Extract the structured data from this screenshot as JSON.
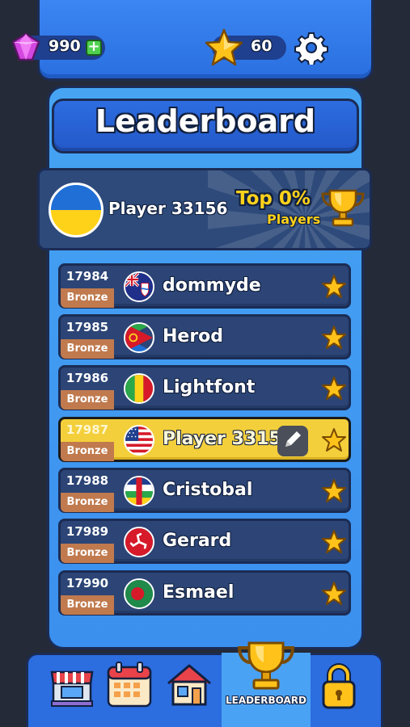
{
  "topbar": {
    "gem_count": "990",
    "plus_label": "+",
    "star_count": "60"
  },
  "title": "Leaderboard",
  "player_card": {
    "name": "Player 33156",
    "top_label": "Top 0%",
    "players_label": "Players"
  },
  "rows": [
    {
      "rank": "17984",
      "tier": "Bronze",
      "name": "dommyde",
      "flag": "cayman-islands",
      "me": false
    },
    {
      "rank": "17985",
      "tier": "Bronze",
      "name": "Herod",
      "flag": "eritrea",
      "me": false
    },
    {
      "rank": "17986",
      "tier": "Bronze",
      "name": "Lightfont",
      "flag": "mali",
      "me": false
    },
    {
      "rank": "17987",
      "tier": "Bronze",
      "name": "Player 33156",
      "flag": "usa",
      "me": true
    },
    {
      "rank": "17988",
      "tier": "Bronze",
      "name": "Cristobal",
      "flag": "central-african-republic",
      "me": false
    },
    {
      "rank": "17989",
      "tier": "Bronze",
      "name": "Gerard",
      "flag": "isle-of-man",
      "me": false
    },
    {
      "rank": "17990",
      "tier": "Bronze",
      "name": "Esmael",
      "flag": "bangladesh",
      "me": false
    }
  ],
  "nav": {
    "active_label": "LEADERBOARD",
    "items": [
      "shop-icon",
      "calendar-icon",
      "home-icon",
      "trophy-icon",
      "lock-icon"
    ]
  },
  "colors": {
    "background": "#242a37",
    "panel": "#46a4f3",
    "highlight_row": "#f3cf3c",
    "gold": "#ffd21a",
    "bronze": "#c07a4e"
  }
}
